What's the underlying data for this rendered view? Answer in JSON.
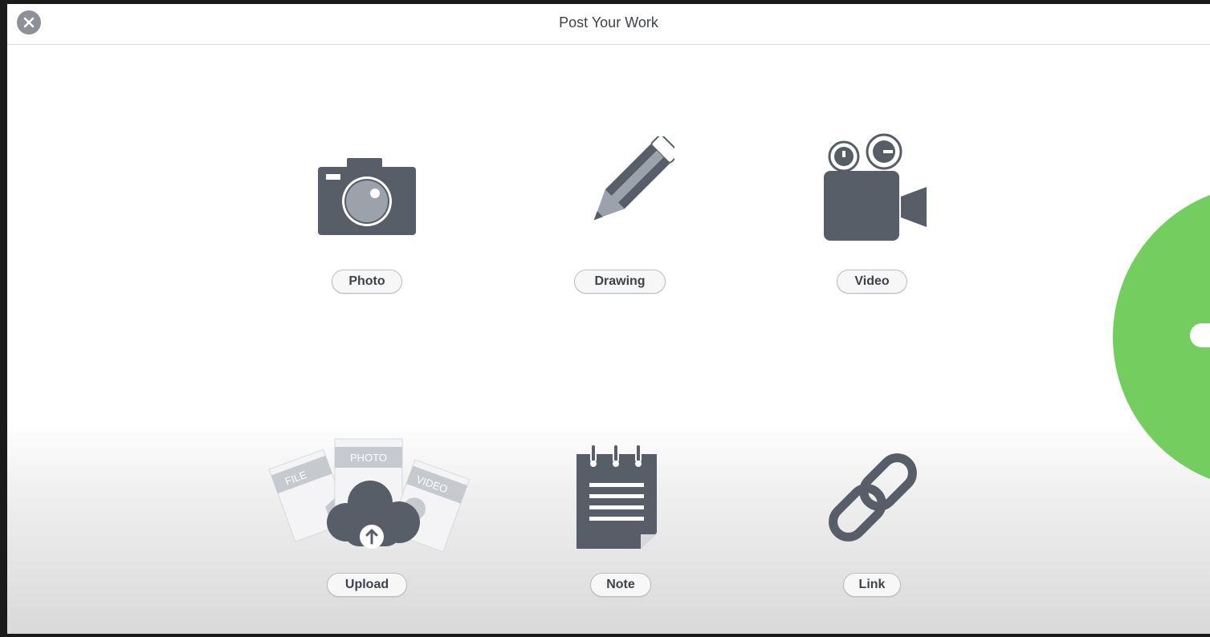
{
  "header": {
    "title": "Post Your Work",
    "close_icon": "close-icon"
  },
  "options": {
    "photo": {
      "label": "Photo",
      "icon": "camera-icon"
    },
    "drawing": {
      "label": "Drawing",
      "icon": "pencil-icon"
    },
    "video": {
      "label": "Video",
      "icon": "video-camera-icon"
    },
    "upload": {
      "label": "Upload",
      "icon": "cloud-upload-icon",
      "card_file": "FILE",
      "card_photo": "PHOTO",
      "card_video": "VIDEO"
    },
    "note": {
      "label": "Note",
      "icon": "notepad-icon"
    },
    "link": {
      "label": "Link",
      "icon": "link-icon"
    }
  },
  "colors": {
    "icon": "#585e68",
    "accent_green": "#73cd5f",
    "pill_border": "#b9bcc0"
  }
}
